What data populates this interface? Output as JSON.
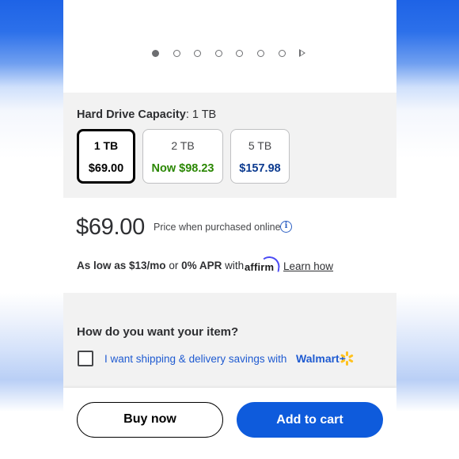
{
  "carousel": {
    "dot_count": 7,
    "active_index": 0,
    "next_icon": "play-next-icon"
  },
  "capacity": {
    "label": "Hard Drive Capacity",
    "selected_value": ": 1 TB",
    "options": [
      {
        "size": "1 TB",
        "price": "$69.00",
        "selected": true
      },
      {
        "size": "2 TB",
        "price": "Now $98.23",
        "selected": false
      },
      {
        "size": "5 TB",
        "price": "$157.98",
        "selected": false
      }
    ]
  },
  "price": {
    "amount": "$69.00",
    "note": "Price when purchased online",
    "info_icon": "info-icon"
  },
  "financing": {
    "low_as": "As low as $13/mo",
    "or": "or",
    "apr": "0% APR",
    "with": "with",
    "brand": "affirm",
    "learn_link": "Learn how"
  },
  "fulfillment": {
    "title": "How do you want your item?",
    "shipping_text": "I want shipping & delivery savings with",
    "walmart_plus": "Walmart+",
    "checked": false
  },
  "actions": {
    "buy_now": "Buy now",
    "add_to_cart": "Add to cart"
  },
  "colors": {
    "accent_blue": "#0e5bdc",
    "savings_green": "#2a8703",
    "link_blue": "#1f5bd1",
    "spark_yellow": "#ffc220"
  }
}
